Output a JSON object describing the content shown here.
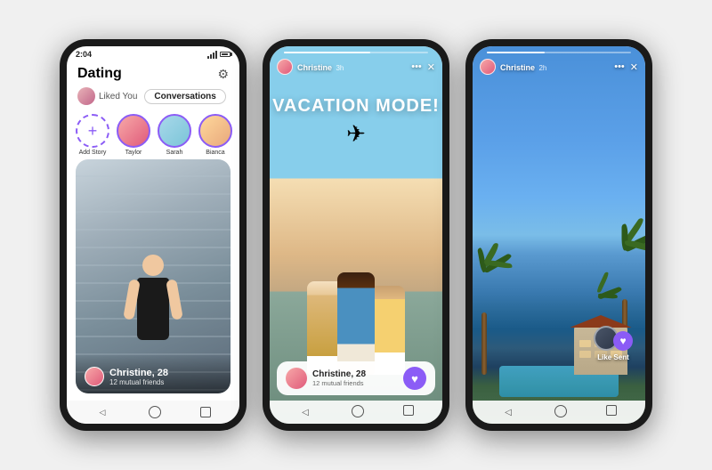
{
  "phone1": {
    "status_time": "2:04",
    "title": "Dating",
    "tab_liked": "Liked You",
    "tab_conversations": "Conversations",
    "stories": [
      {
        "label": "Add Story",
        "type": "add"
      },
      {
        "label": "Taylor",
        "type": "avatar",
        "class": "taylor"
      },
      {
        "label": "Sarah",
        "type": "avatar",
        "class": "sarah"
      },
      {
        "label": "Bianca",
        "type": "avatar",
        "class": "bianca"
      }
    ],
    "profile": {
      "name": "Christine, 28",
      "mutual": "12 mutual friends"
    },
    "nav": [
      "◁",
      "○",
      "□"
    ]
  },
  "phone2": {
    "user_name": "Christine",
    "time_ago": "3h",
    "story_text": "VACATION MODE!",
    "plane": "✈",
    "progress": "60",
    "profile": {
      "name": "Christine, 28",
      "mutual": "12 mutual friends"
    },
    "icons": {
      "more": "•••",
      "close": "✕"
    },
    "nav": [
      "◁",
      "○",
      "□"
    ]
  },
  "phone3": {
    "user_name": "Christine",
    "time_ago": "2h",
    "progress": "40",
    "like_sent_label": "Like Sent",
    "icons": {
      "more": "•••",
      "close": "✕"
    },
    "nav": [
      "◁",
      "○",
      "□"
    ]
  },
  "colors": {
    "purple": "#8b5cf6",
    "dark": "#1a1a1a"
  }
}
